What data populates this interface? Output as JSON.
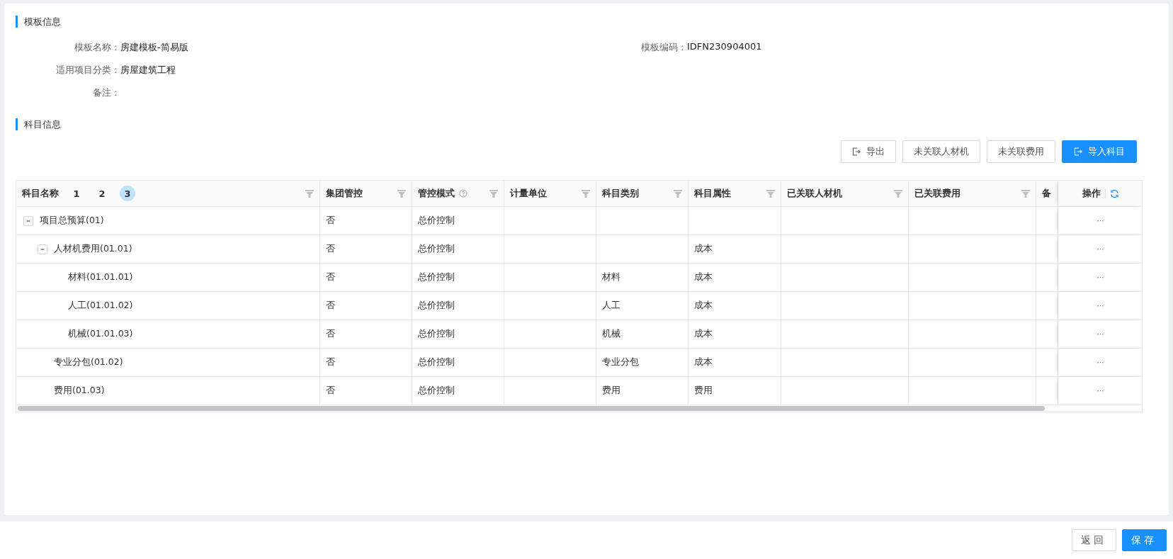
{
  "template_info": {
    "title": "模板信息",
    "rows": [
      [
        {
          "label": "模板名称：",
          "value": "房建模板-简易版"
        },
        {
          "label": "模板编码：",
          "value": "IDFN230904001"
        }
      ],
      [
        {
          "label": "适用项目分类：",
          "value": "房屋建筑工程"
        }
      ],
      [
        {
          "label": "备注："
        }
      ]
    ]
  },
  "subjects": {
    "title": "科目信息",
    "buttons": [
      {
        "label": "导出",
        "kind": "export"
      },
      {
        "label": "未关联人材机",
        "kind": "plain"
      },
      {
        "label": "未关联费用",
        "kind": "plain"
      },
      {
        "label": "导入科目",
        "kind": "primary"
      }
    ],
    "level_buttons": [
      {
        "label": "1",
        "selected": false
      },
      {
        "label": "2",
        "selected": false
      },
      {
        "label": "3",
        "selected": true
      }
    ],
    "columns": [
      {
        "label": "科目名称",
        "filter": true
      },
      {
        "label": "集团管控",
        "filter": true
      },
      {
        "label": "管控模式",
        "filter": true,
        "help": true
      },
      {
        "label": "计量单位",
        "filter": true
      },
      {
        "label": "科目类别",
        "filter": true
      },
      {
        "label": "科目属性",
        "filter": true
      },
      {
        "label": "已关联人材机",
        "filter": true
      },
      {
        "label": "已关联费用",
        "filter": true
      },
      {
        "label": "备",
        "filter": false
      }
    ],
    "action_column": {
      "label": "操作"
    },
    "rows": [
      {
        "expanded": true,
        "cells": [
          "项目总预算(01)",
          "否",
          "总价控制",
          "",
          "",
          "",
          "",
          "",
          ""
        ],
        "action": "···",
        "children": [
          {
            "expanded": true,
            "cells": [
              "人材机费用(01.01)",
              "否",
              "总价控制",
              "",
              "",
              "成本",
              "",
              "",
              ""
            ],
            "action": "···",
            "children": [
              {
                "cells": [
                  "材料(01.01.01)",
                  "否",
                  "总价控制",
                  "",
                  "材料",
                  "成本",
                  "",
                  "",
                  ""
                ],
                "action": "···"
              },
              {
                "cells": [
                  "人工(01.01.02)",
                  "否",
                  "总价控制",
                  "",
                  "人工",
                  "成本",
                  "",
                  "",
                  ""
                ],
                "action": "···"
              },
              {
                "cells": [
                  "机械(01.01.03)",
                  "否",
                  "总价控制",
                  "",
                  "机械",
                  "成本",
                  "",
                  "",
                  ""
                ],
                "action": "···"
              }
            ]
          },
          {
            "cells": [
              "专业分包(01.02)",
              "否",
              "总价控制",
              "",
              "专业分包",
              "成本",
              "",
              "",
              ""
            ],
            "action": "···"
          },
          {
            "cells": [
              "费用(01.03)",
              "否",
              "总价控制",
              "",
              "费用",
              "费用",
              "",
              "",
              ""
            ],
            "action": "···"
          }
        ]
      }
    ]
  },
  "footer": {
    "buttons": [
      {
        "label": "返回",
        "kind": "plain"
      },
      {
        "label": "保存",
        "kind": "primary"
      }
    ]
  }
}
